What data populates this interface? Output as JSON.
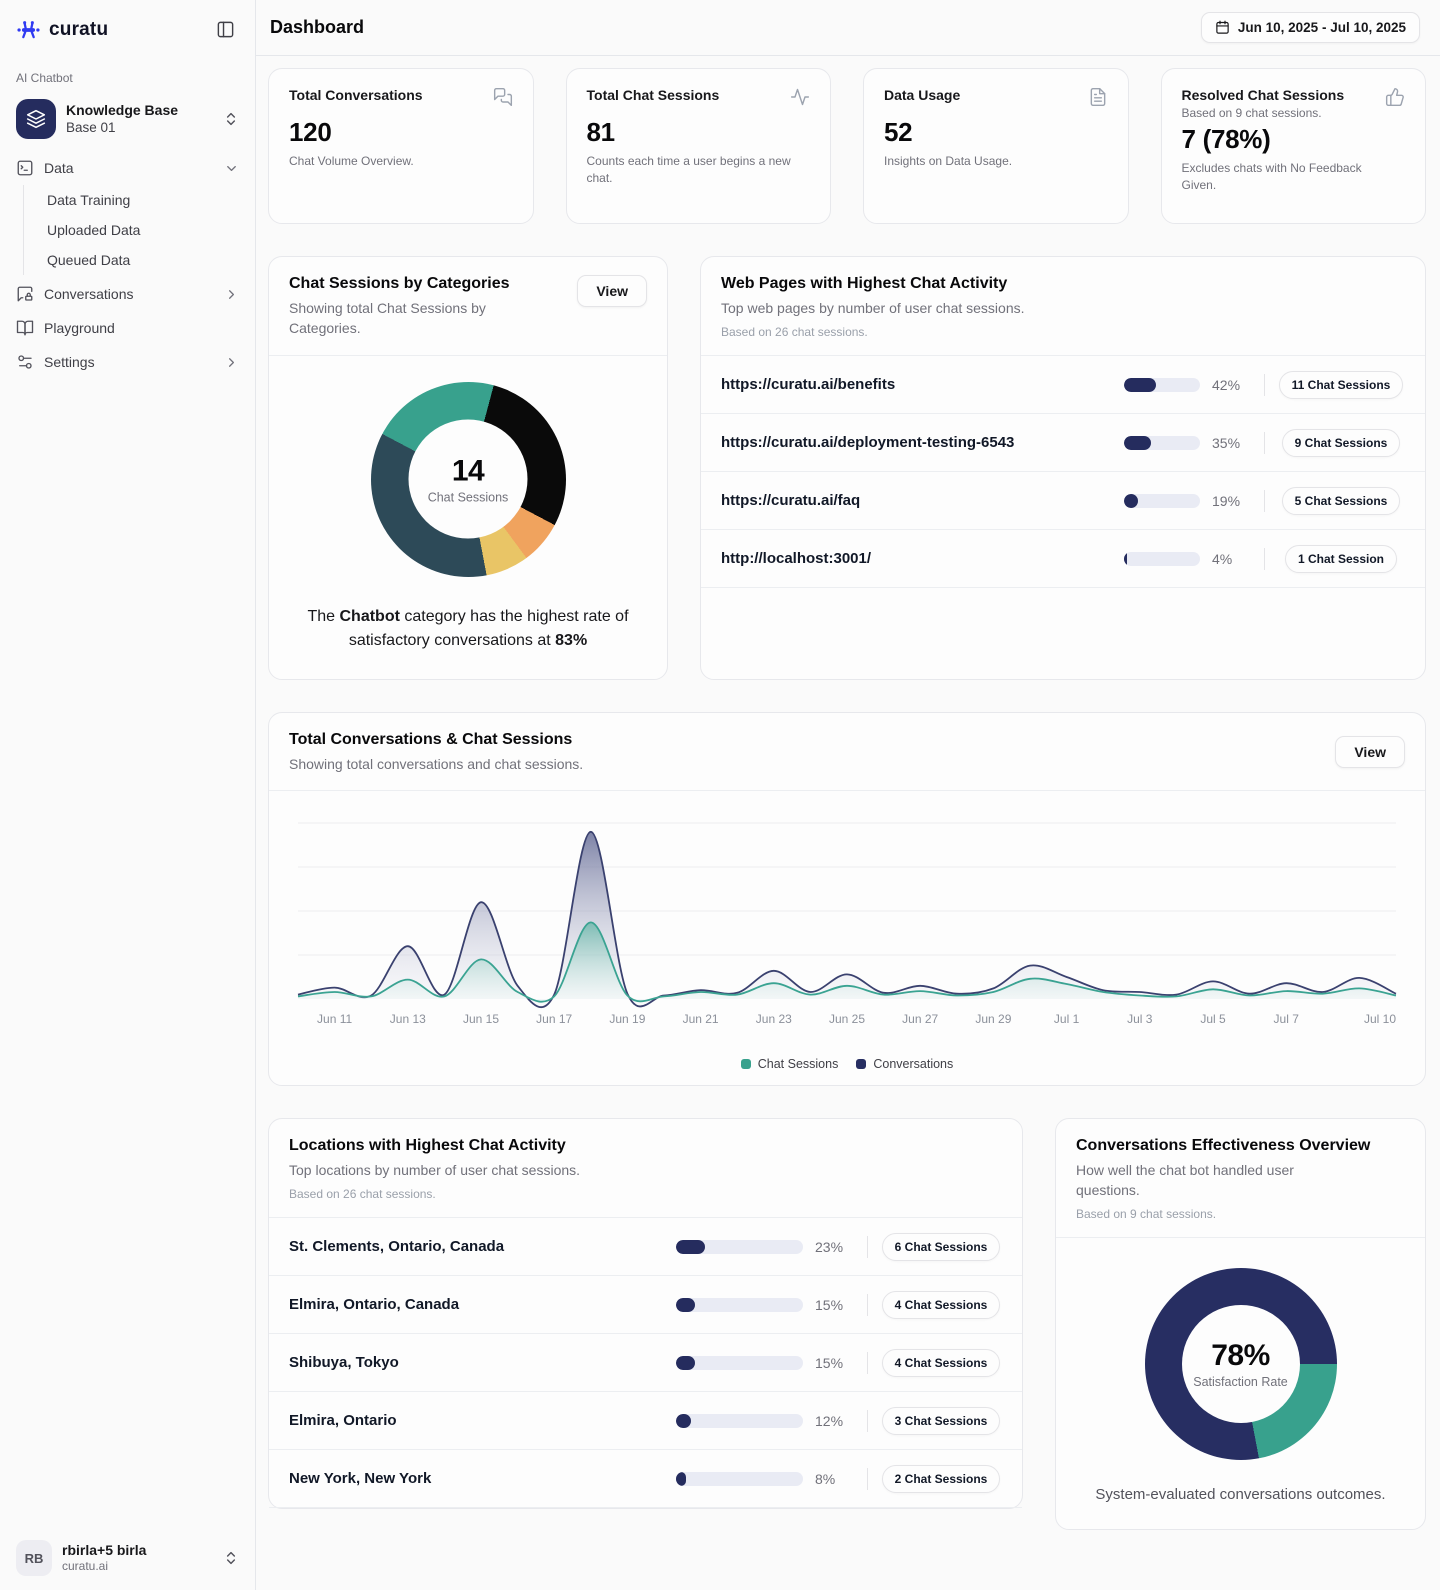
{
  "sidebar": {
    "logo_text": "curatu",
    "section_label": "AI Chatbot",
    "kb": {
      "title": "Knowledge Base",
      "subtitle": "Base 01"
    },
    "nav": {
      "data": "Data",
      "conversations": "Conversations",
      "playground": "Playground",
      "settings": "Settings"
    },
    "data_children": [
      "Data Training",
      "Uploaded Data",
      "Queued Data"
    ],
    "user": {
      "initials": "RB",
      "name": "rbirla+5 birla",
      "org": "curatu.ai"
    }
  },
  "header": {
    "title": "Dashboard",
    "date_range": "Jun 10, 2025 - Jul 10, 2025"
  },
  "stats": [
    {
      "title": "Total Conversations",
      "value": "120",
      "desc": "Chat Volume Overview.",
      "icon": "messages-icon"
    },
    {
      "title": "Total Chat Sessions",
      "value": "81",
      "desc": "Counts each time a user begins a new chat.",
      "icon": "activity-icon"
    },
    {
      "title": "Data Usage",
      "value": "52",
      "desc": "Insights on Data Usage.",
      "icon": "file-text-icon"
    },
    {
      "title": "Resolved Chat Sessions",
      "basis": "Based on 9 chat sessions.",
      "value": "7 (78%)",
      "desc": "Excludes chats with No Feedback Given.",
      "icon": "thumbs-up-icon"
    }
  ],
  "categories_card": {
    "title": "Chat Sessions by Categories",
    "subtitle": "Showing total Chat Sessions by Categories.",
    "view_label": "View",
    "center_value": "14",
    "center_label": "Chat Sessions",
    "insight": {
      "prefix": "The ",
      "bold1": "Chatbot",
      "middle": " category has the highest rate of satisfactory conversations at ",
      "bold2": "83%"
    }
  },
  "webpages_card": {
    "title": "Web Pages with Highest Chat Activity",
    "subtitle": "Top web pages by number of user chat sessions.",
    "basis": "Based on 26 chat sessions.",
    "rows": [
      {
        "label": "https://curatu.ai/benefits",
        "pct": 42,
        "percent": "42%",
        "badge": "11 Chat Sessions"
      },
      {
        "label": "https://curatu.ai/deployment-testing-6543",
        "pct": 35,
        "percent": "35%",
        "badge": "9 Chat Sessions"
      },
      {
        "label": "https://curatu.ai/faq",
        "pct": 19,
        "percent": "19%",
        "badge": "5 Chat Sessions"
      },
      {
        "label": "http://localhost:3001/",
        "pct": 4,
        "percent": "4%",
        "badge": "1 Chat Session"
      }
    ]
  },
  "trend_card": {
    "title": "Total Conversations & Chat Sessions",
    "subtitle": "Showing total conversations and chat sessions.",
    "view_label": "View",
    "legend": [
      {
        "label": "Chat Sessions",
        "color": "#38a18d"
      },
      {
        "label": "Conversations",
        "color": "#272e62"
      }
    ]
  },
  "locations_card": {
    "title": "Locations with Highest Chat Activity",
    "subtitle": "Top locations by number of user chat sessions.",
    "basis": "Based on 26 chat sessions.",
    "rows": [
      {
        "label": "St. Clements, Ontario, Canada",
        "pct": 23,
        "percent": "23%",
        "badge": "6 Chat Sessions"
      },
      {
        "label": "Elmira, Ontario, Canada",
        "pct": 15,
        "percent": "15%",
        "badge": "4 Chat Sessions"
      },
      {
        "label": "Shibuya, Tokyo",
        "pct": 15,
        "percent": "15%",
        "badge": "4 Chat Sessions"
      },
      {
        "label": "Elmira, Ontario",
        "pct": 12,
        "percent": "12%",
        "badge": "3 Chat Sessions"
      },
      {
        "label": "New York, New York",
        "pct": 8,
        "percent": "8%",
        "badge": "2 Chat Sessions"
      }
    ]
  },
  "effectiveness_card": {
    "title": "Conversations Effectiveness Overview",
    "subtitle": "How well the chat bot handled user questions.",
    "basis": "Based on 9 chat sessions.",
    "center_value": "78%",
    "center_label": "Satisfaction Rate",
    "caption": "System-evaluated conversations outcomes."
  },
  "colors": {
    "accent_navy": "#252c5e",
    "accent_teal": "#38a18d",
    "brand_blue": "#2f3af2"
  },
  "chart_data": [
    {
      "type": "pie",
      "title": "Chat Sessions by Categories",
      "total": 14,
      "center_value": "14",
      "center_label": "Chat Sessions",
      "start_angle_deg": 15,
      "segments": [
        {
          "value": 4,
          "color": "#0a0a0a"
        },
        {
          "value": 1,
          "color": "#f0a35e"
        },
        {
          "value": 1,
          "color": "#e9c566"
        },
        {
          "value": 5,
          "color": "#2d4a58"
        },
        {
          "value": 3,
          "color": "#38a18d"
        }
      ]
    },
    {
      "type": "area",
      "title": "Total Conversations & Chat Sessions",
      "ylim": [
        0,
        20
      ],
      "grid": true,
      "legend_position": "bottom",
      "x": [
        "Jun 10",
        "Jun 11",
        "Jun 12",
        "Jun 13",
        "Jun 14",
        "Jun 15",
        "Jun 16",
        "Jun 17",
        "Jun 18",
        "Jun 19",
        "Jun 20",
        "Jun 21",
        "Jun 22",
        "Jun 23",
        "Jun 24",
        "Jun 25",
        "Jun 26",
        "Jun 27",
        "Jun 28",
        "Jun 29",
        "Jun 30",
        "Jul 1",
        "Jul 2",
        "Jul 3",
        "Jul 4",
        "Jul 5",
        "Jul 6",
        "Jul 7",
        "Jul 8",
        "Jul 9",
        "Jul 10"
      ],
      "ticks": [
        {
          "i": 1,
          "label": "Jun 11"
        },
        {
          "i": 3,
          "label": "Jun 13"
        },
        {
          "i": 5,
          "label": "Jun 15"
        },
        {
          "i": 7,
          "label": "Jun 17"
        },
        {
          "i": 9,
          "label": "Jun 19"
        },
        {
          "i": 11,
          "label": "Jun 21"
        },
        {
          "i": 13,
          "label": "Jun 23"
        },
        {
          "i": 15,
          "label": "Jun 25"
        },
        {
          "i": 17,
          "label": "Jun 27"
        },
        {
          "i": 19,
          "label": "Jun 29"
        },
        {
          "i": 21,
          "label": "Jul 1"
        },
        {
          "i": 23,
          "label": "Jul 3"
        },
        {
          "i": 25,
          "label": "Jul 5"
        },
        {
          "i": 27,
          "label": "Jul 7"
        },
        {
          "i": 30,
          "label": "Jul 10"
        }
      ],
      "series": [
        {
          "name": "Chat Sessions",
          "color": "#38a18d",
          "values": [
            0.3,
            0.8,
            0.3,
            2.2,
            0.3,
            4.5,
            0.8,
            0.3,
            8.7,
            0.4,
            0.3,
            0.8,
            0.5,
            1.8,
            0.5,
            1.5,
            0.5,
            0.9,
            0.4,
            0.8,
            2.3,
            1.7,
            0.8,
            0.4,
            0.3,
            1.1,
            0.4,
            0.9,
            0.6,
            1.2,
            0.4
          ]
        },
        {
          "name": "Conversations",
          "color": "#272e62",
          "values": [
            0.5,
            1.3,
            0.4,
            6,
            0.5,
            11,
            1.5,
            0.5,
            19,
            0.6,
            0.4,
            1.0,
            0.7,
            3.2,
            0.8,
            2.8,
            0.7,
            1.5,
            0.6,
            1.2,
            3.8,
            2.5,
            1.0,
            0.8,
            0.5,
            2.0,
            0.6,
            1.8,
            0.8,
            2.4,
            0.6
          ]
        }
      ]
    },
    {
      "type": "pie",
      "title": "Conversations Effectiveness Overview",
      "center_value": "78%",
      "center_label": "Satisfaction Rate",
      "start_angle_deg": 90,
      "segments": [
        {
          "value": 22,
          "color": "#38a18d"
        },
        {
          "value": 78,
          "color": "#272e62"
        }
      ]
    }
  ]
}
